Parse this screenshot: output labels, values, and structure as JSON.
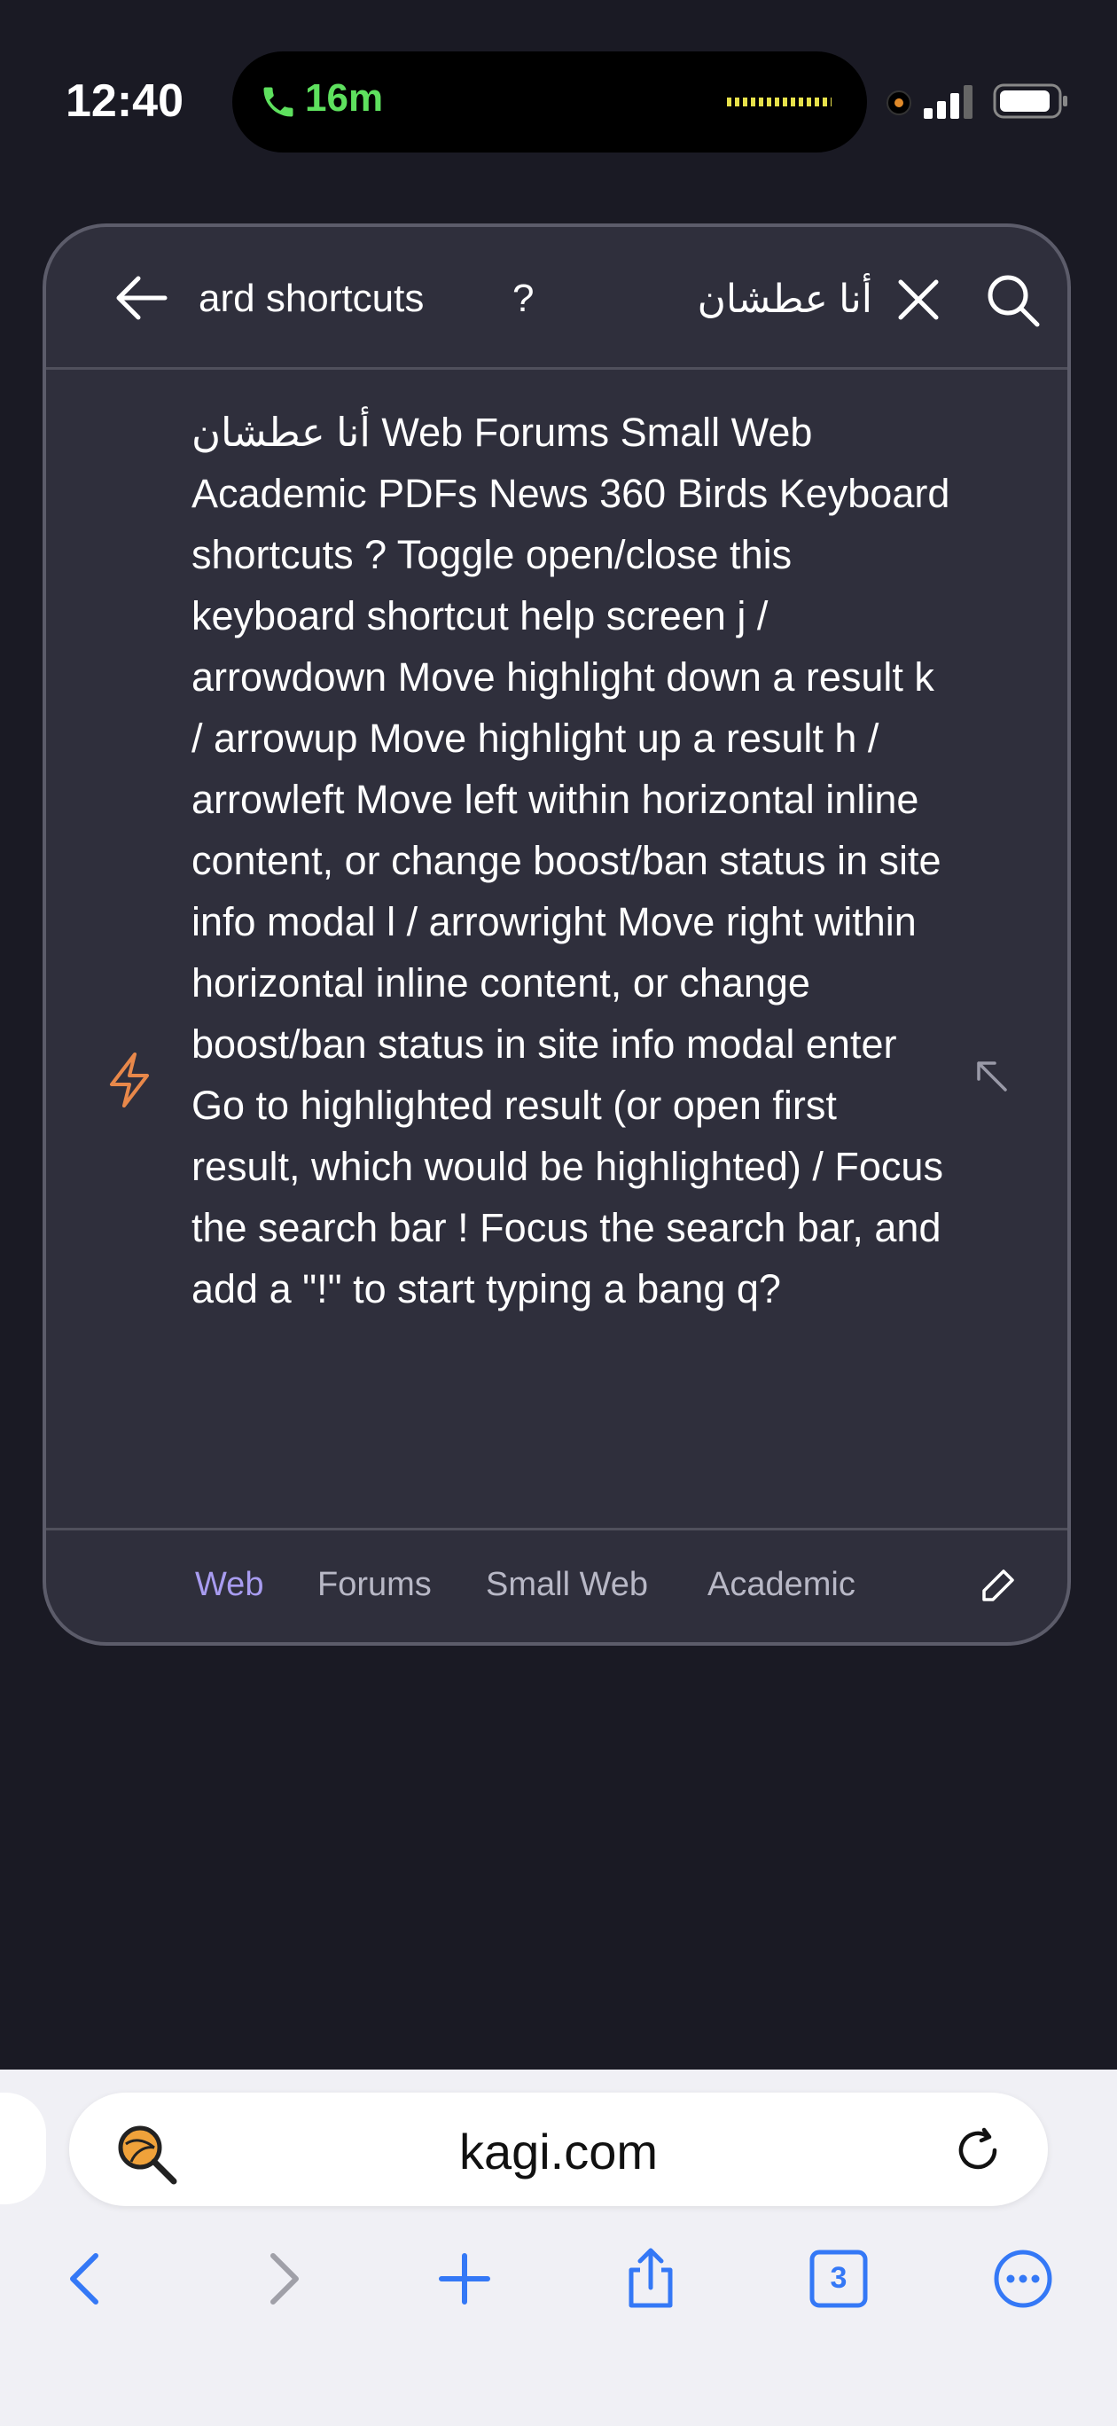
{
  "status": {
    "time": "12:40",
    "call_duration": "16m"
  },
  "search": {
    "query_visible_left": "ard shortcuts",
    "query_visible_mid": "?",
    "query_arabic": "أنا عطشان"
  },
  "suggestion": {
    "text": "أنا عطشان Web Forums Small Web Academic PDFs News 360 Birds Keyboard shortcuts ? Toggle open/close this keyboard shortcut help screen j / arrowdown Move highlight down a result k / arrowup Move highlight up a result h / arrowleft Move left within horizontal inline content, or change boost/ban status in site info modal l / arrowright Move right within horizontal inline content, or change boost/ban status in site info modal enter Go to highlighted result (or open first result, which would be highlighted) / Focus the search bar ! Focus the search bar, and add a \"!\" to start typing a bang q?"
  },
  "tabs": [
    {
      "label": "Web",
      "active": true
    },
    {
      "label": "Forums",
      "active": false
    },
    {
      "label": "Small Web",
      "active": false
    },
    {
      "label": "Academic",
      "active": false
    }
  ],
  "browser": {
    "url": "kagi.com",
    "tab_count": "3"
  },
  "colors": {
    "accent": "#3478f6",
    "bolt": "#e8884a",
    "active_tab": "#a89cf0"
  },
  "icons": [
    "back-arrow-icon",
    "clear-icon",
    "search-icon",
    "bolt-icon",
    "fill-arrow-icon",
    "edit-icon",
    "kagi-icon",
    "reload-icon",
    "nav-back-icon",
    "nav-forward-icon",
    "new-tab-icon",
    "share-icon",
    "tabs-icon",
    "more-icon"
  ]
}
